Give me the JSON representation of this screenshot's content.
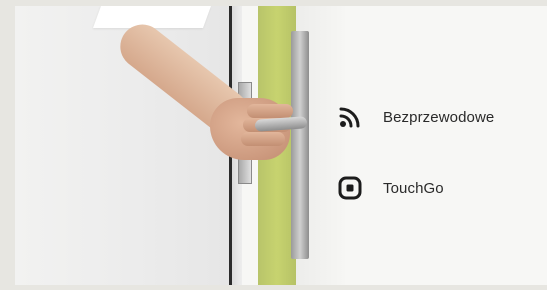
{
  "features": [
    {
      "icon": "wireless-signal-icon",
      "label": "Bezprzewodowe"
    },
    {
      "icon": "touchgo-icon",
      "label": "TouchGo"
    }
  ],
  "colors": {
    "background": "#e7e6e1",
    "card": "#f7f7f5",
    "text": "#2a2a2a",
    "icon": "#1c1c1c",
    "door_accent": "#c2cf6c"
  }
}
